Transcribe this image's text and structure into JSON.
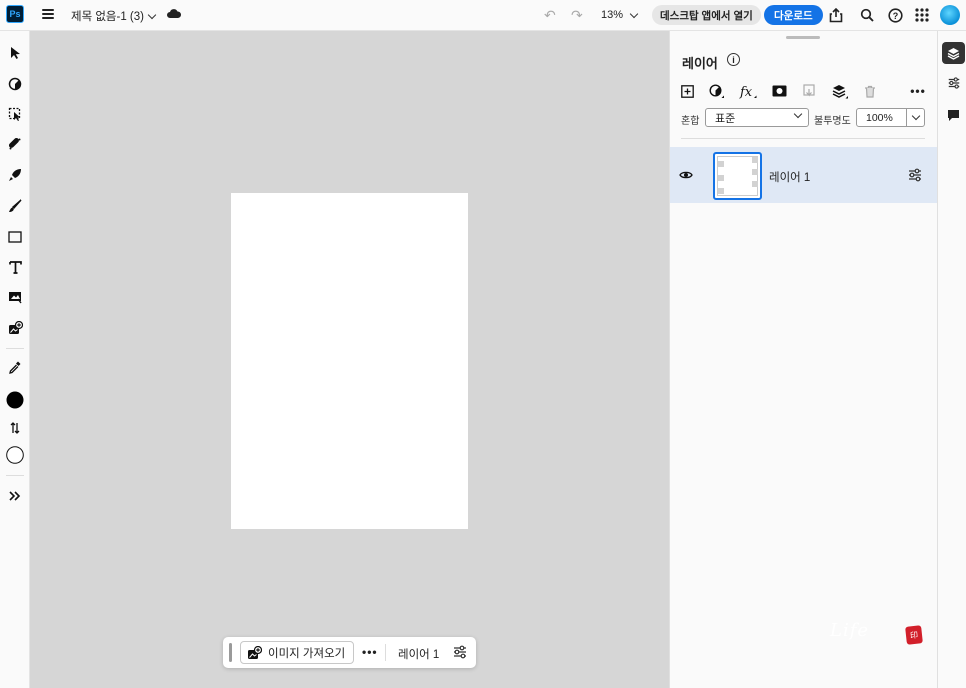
{
  "app": {
    "logo_text": "Ps",
    "document_title": "제목 없음-1 (3)"
  },
  "topbar": {
    "zoom": "13%",
    "open_desktop_label": "데스크탑 앱에서 열기",
    "download_label": "다운로드",
    "accent_color": "#1473e6"
  },
  "toolbar": {
    "tools": [
      "move-icon",
      "adjust-icon",
      "select-icon",
      "heal-icon",
      "quick-action-icon",
      "brush-icon",
      "rectangle-icon",
      "type-icon",
      "crop-icon",
      "add-image-icon",
      "eyedropper-icon"
    ],
    "foreground_color": "#000000",
    "background_color": "#ffffff"
  },
  "taskbar": {
    "import_label": "이미지 가져오기",
    "layer_label": "레이어 1"
  },
  "layers_panel": {
    "title": "레이어",
    "blend_label": "혼합",
    "blend_mode": "표준",
    "opacity_label": "불투명도",
    "opacity_value": "100%",
    "layers": [
      {
        "name": "레이어 1",
        "visible": true,
        "selected": true
      }
    ]
  },
  "watermark": {
    "text": "Life",
    "stamp": "印"
  }
}
